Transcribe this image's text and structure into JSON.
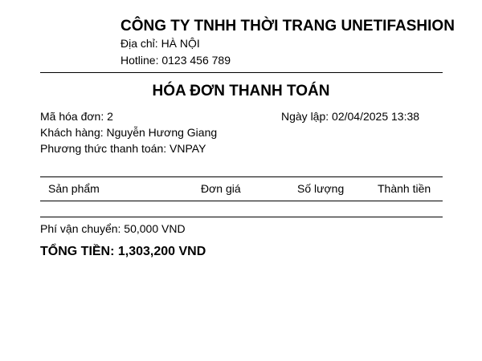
{
  "company": {
    "name": "CÔNG TY TNHH THỜI TRANG UNETIFASHION",
    "address": "Địa chỉ: HÀ NỘI",
    "hotline": "Hotline: 0123 456 789"
  },
  "invoice": {
    "title": "HÓA ĐƠN THANH TOÁN",
    "number": "Mã hóa đơn: 2",
    "date": "Ngày lập: 02/04/2025 13:38",
    "customer": "Khách hàng: Nguyễn Hương Giang",
    "payment_method": "Phương thức thanh toán: VNPAY"
  },
  "table": {
    "headers": [
      "Sản phẩm",
      "Đơn giá",
      "Số lượng",
      "Thành tiền"
    ],
    "rows": []
  },
  "summary": {
    "shipping": "Phí vận chuyển: 50,000 VND",
    "total": "TỔNG TIỀN: 1,303,200 VND"
  }
}
